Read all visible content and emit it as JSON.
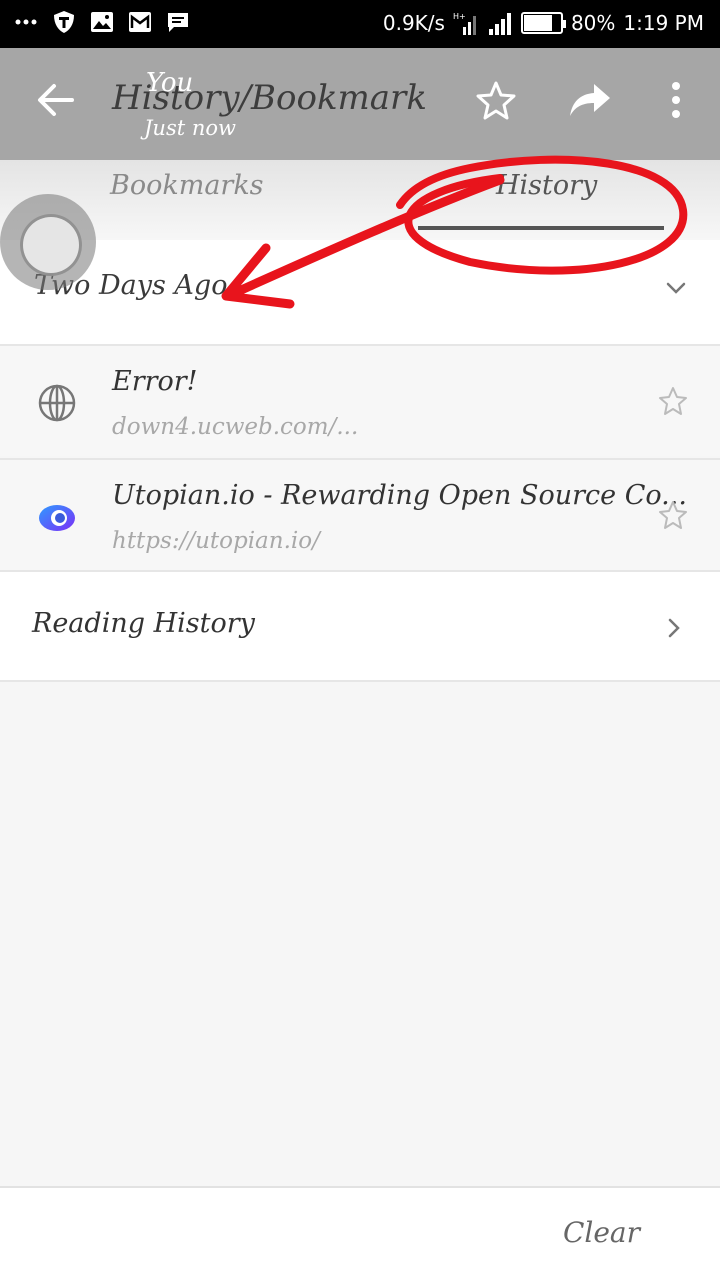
{
  "status_bar": {
    "net_speed": "0.9K/s",
    "network_type": "H+",
    "battery_percent": 80,
    "battery_label": "80%",
    "time": "1:19 PM",
    "left_icons": [
      "more-dots-icon",
      "shield-app-icon",
      "gallery-icon",
      "mail-icon",
      "message-icon"
    ]
  },
  "toolbar": {
    "title": "History/Bookmark",
    "overlay_name": "You",
    "overlay_time": "Just now",
    "icons": [
      "back-arrow-icon",
      "star-outline-icon",
      "share-icon",
      "more-vert-icon"
    ]
  },
  "tabs": [
    {
      "label": "Bookmarks",
      "selected": false
    },
    {
      "label": "History",
      "selected": true
    }
  ],
  "history": {
    "group_label": "Two Days Ago",
    "items": [
      {
        "title": "Error!",
        "url": "down4.ucweb.com/...",
        "icon": "globe-icon"
      },
      {
        "title": "Utopian.io - Rewarding Open Source Co...",
        "url": "https://utopian.io/",
        "icon": "utopian-logo-icon"
      }
    ],
    "reading_history_label": "Reading History"
  },
  "footer": {
    "clear_label": "Clear"
  },
  "colors": {
    "toolbar_bg": "#a6a6a6",
    "annotation_red": "#e8141c",
    "utopian_blue": "#3b5bdb",
    "utopian_purple": "#7b2ff7"
  }
}
